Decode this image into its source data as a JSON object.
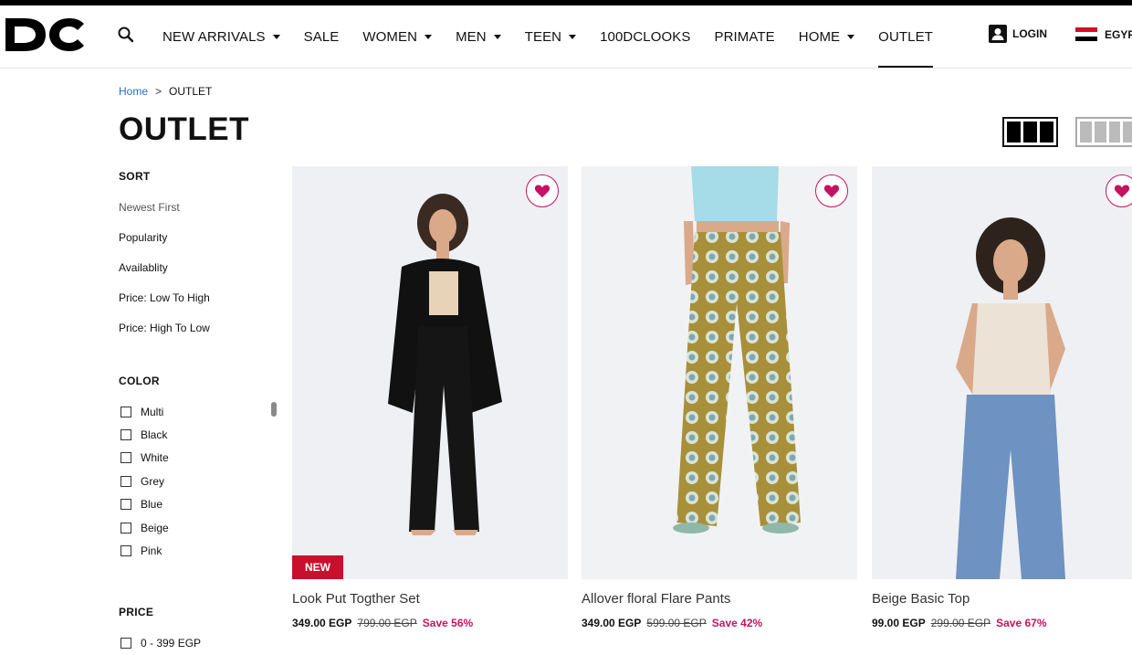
{
  "header": {
    "logo_text": "DC",
    "nav": [
      {
        "label": "NEW ARRIVALS",
        "dropdown": true,
        "active": false
      },
      {
        "label": "SALE",
        "dropdown": false,
        "active": false
      },
      {
        "label": "WOMEN",
        "dropdown": true,
        "active": false
      },
      {
        "label": "MEN",
        "dropdown": true,
        "active": false
      },
      {
        "label": "TEEN",
        "dropdown": true,
        "active": false
      },
      {
        "label": "100DCLOOKS",
        "dropdown": false,
        "active": false
      },
      {
        "label": "PRIMATE",
        "dropdown": false,
        "active": false
      },
      {
        "label": "HOME",
        "dropdown": true,
        "active": false
      },
      {
        "label": "OUTLET",
        "dropdown": false,
        "active": true
      }
    ],
    "login_label": "LOGIN",
    "country_label": "EGYPT"
  },
  "breadcrumb": {
    "home": "Home",
    "separator": ">",
    "current": "OUTLET"
  },
  "page_title": "OUTLET",
  "sidebar": {
    "sort_title": "SORT",
    "sort_options": [
      "Newest First",
      "Popularity",
      "Availablity",
      "Price: Low To High",
      "Price: High To Low"
    ],
    "color_title": "COLOR",
    "colors": [
      "Multi",
      "Black",
      "White",
      "Grey",
      "Blue",
      "Beige",
      "Pink"
    ],
    "price_title": "PRICE",
    "price_ranges": [
      "0 - 399 EGP"
    ]
  },
  "products": [
    {
      "name": "Look Put Togther Set",
      "price": "349.00 EGP",
      "old_price": "799.00 EGP",
      "save": "Save 56%",
      "badge": "NEW"
    },
    {
      "name": "Allover floral Flare Pants",
      "price": "349.00 EGP",
      "old_price": "599.00 EGP",
      "save": "Save 42%",
      "badge": ""
    },
    {
      "name": "Beige Basic Top",
      "price": "99.00 EGP",
      "old_price": "299.00 EGP",
      "save": "Save 67%",
      "badge": ""
    }
  ],
  "colors": {
    "accent": "#c4145f",
    "badge": "#c8102e",
    "link": "#2a6fc9"
  }
}
